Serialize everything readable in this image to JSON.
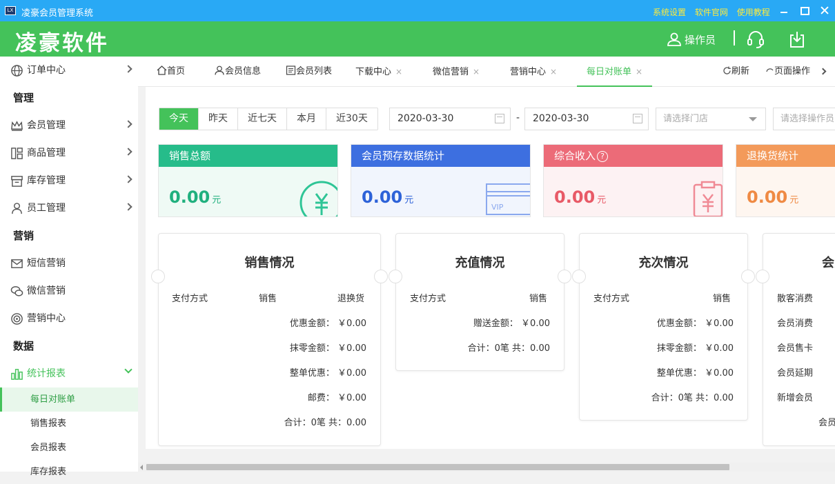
{
  "window": {
    "app_icon_text": "LX",
    "title": "凌豪会员管理系统",
    "links": [
      "系统设置",
      "软件官网",
      "使用教程"
    ]
  },
  "header": {
    "logo": "凌豪软件",
    "user_label": "操作员"
  },
  "sidebar": {
    "items": [
      {
        "type": "item",
        "label": "订单中心",
        "icon": "globe-icon"
      },
      {
        "type": "category",
        "label": "管理"
      },
      {
        "type": "item",
        "label": "会员管理",
        "icon": "crown-icon"
      },
      {
        "type": "item",
        "label": "商品管理",
        "icon": "grid-icon"
      },
      {
        "type": "item",
        "label": "库存管理",
        "icon": "box-icon"
      },
      {
        "type": "item",
        "label": "员工管理",
        "icon": "person-icon"
      },
      {
        "type": "category",
        "label": "营销"
      },
      {
        "type": "item",
        "label": "短信营销",
        "icon": "mail-icon"
      },
      {
        "type": "item",
        "label": "微信营销",
        "icon": "wechat-icon"
      },
      {
        "type": "item",
        "label": "营销中心",
        "icon": "target-icon"
      },
      {
        "type": "category",
        "label": "数据"
      },
      {
        "type": "item",
        "label": "统计报表",
        "icon": "bar-chart-icon",
        "open": true
      },
      {
        "type": "sub",
        "label": "每日对账单",
        "active": true
      },
      {
        "type": "sub",
        "label": "销售报表"
      },
      {
        "type": "sub",
        "label": "会员报表"
      },
      {
        "type": "sub",
        "label": "库存报表"
      }
    ]
  },
  "tabs": {
    "items": [
      {
        "label": "首页",
        "icon": "home-icon"
      },
      {
        "label": "会员信息",
        "icon": "user-icon"
      },
      {
        "label": "会员列表",
        "icon": "list-icon"
      },
      {
        "label": "下载中心",
        "closable": true
      },
      {
        "label": "微信营销",
        "closable": true
      },
      {
        "label": "营销中心",
        "closable": true
      },
      {
        "label": "每日对账单",
        "closable": true,
        "active": true
      }
    ],
    "close_glyph": "×",
    "refresh": "刷新",
    "page_ops": "页面操作"
  },
  "filters": {
    "ranges": [
      "今天",
      "昨天",
      "近七天",
      "本月",
      "近30天"
    ],
    "active_range": "今天",
    "start_date": "2020-03-30",
    "separator": "-",
    "end_date": "2020-03-30",
    "store_placeholder": "请选择门店",
    "operator_placeholder": "请选择操作员"
  },
  "stats": [
    {
      "title": "销售总额",
      "value": "0.00",
      "unit": "元",
      "color": "#26bc8a",
      "bg": "#effaf5",
      "valcolor": "#20b07e"
    },
    {
      "title": "会员预存数据统计",
      "value": "0.00",
      "unit": "元",
      "color": "#3d6fe0",
      "bg": "#f1f5fd",
      "valcolor": "#2d62d8"
    },
    {
      "title": "综合收入",
      "value": "0.00",
      "unit": "元",
      "color": "#ec6b78",
      "bg": "#fdf2f3",
      "valcolor": "#e85a67",
      "help": "?"
    },
    {
      "title": "退换货统计",
      "value": "0.00",
      "unit": "元",
      "color": "#f39a5a",
      "bg": "#fef6f0",
      "valcolor": "#ef8a44"
    }
  ],
  "cards": {
    "sales": {
      "title": "销售情况",
      "headers": [
        "支付方式",
        "销售",
        "退换货"
      ],
      "rows": [
        "优惠金额： ￥0.00",
        "抹零金额： ￥0.00",
        "整单优惠： ￥0.00",
        "邮费： ￥0.00",
        "合计：0笔 共：0.00"
      ]
    },
    "recharge": {
      "title": "充值情况",
      "headers": [
        "支付方式",
        "销售"
      ],
      "rows": [
        "赠送金额： ￥0.00",
        "合计：0笔 共：0.00"
      ]
    },
    "times": {
      "title": "充次情况",
      "headers": [
        "支付方式",
        "销售"
      ],
      "rows": [
        "优惠金额： ￥0.00",
        "抹零金额： ￥0.00",
        "整单优惠： ￥0.00",
        "合计：0笔 共：0.00"
      ]
    },
    "member": {
      "title": "会员",
      "rows": [
        "散客消费",
        "会员消费",
        "会员售卡",
        "会员延期",
        "新增会员",
        "会员"
      ]
    }
  },
  "colors": {
    "brand_green": "#44c25a",
    "titlebar_blue": "#29a9f5",
    "link_yellow": "#ffeb3b"
  }
}
